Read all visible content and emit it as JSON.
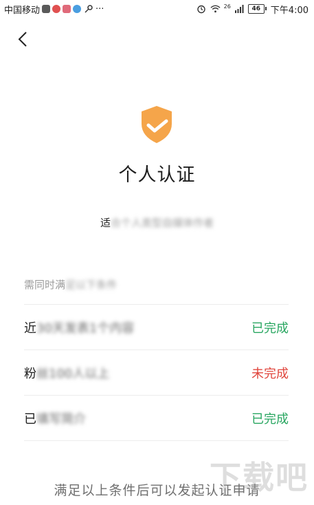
{
  "status_bar": {
    "carrier": "中国移动",
    "signal_label": "26",
    "battery": "46",
    "time": "下午4:00",
    "more": "···"
  },
  "page": {
    "title": "个人认证",
    "subtitle_visible": "适",
    "subtitle_blurred": "合个人类型自媒体作者",
    "requirements_header_visible": "需同时满",
    "requirements_header_blurred": "足以下条件",
    "requirements": [
      {
        "label_visible": "近",
        "label_blurred": "30天发表1个内容",
        "status": "已完成",
        "status_color": "#28a660"
      },
      {
        "label_visible": "粉",
        "label_blurred": "丝100人以上",
        "status": "未完成",
        "status_color": "#e0463d"
      },
      {
        "label_visible": "已",
        "label_blurred": "填写简介",
        "status": "已完成",
        "status_color": "#28a660"
      }
    ],
    "footer_note": "满足以上条件后可以发起认证申请",
    "watermark": "下载吧"
  },
  "colors": {
    "shield": "#f5a54a",
    "done": "#28a660",
    "undone": "#e0463d"
  },
  "icons": [
    "back-icon",
    "shield-check-icon",
    "alarm-icon",
    "wifi-icon",
    "signal-icon",
    "battery-icon"
  ]
}
